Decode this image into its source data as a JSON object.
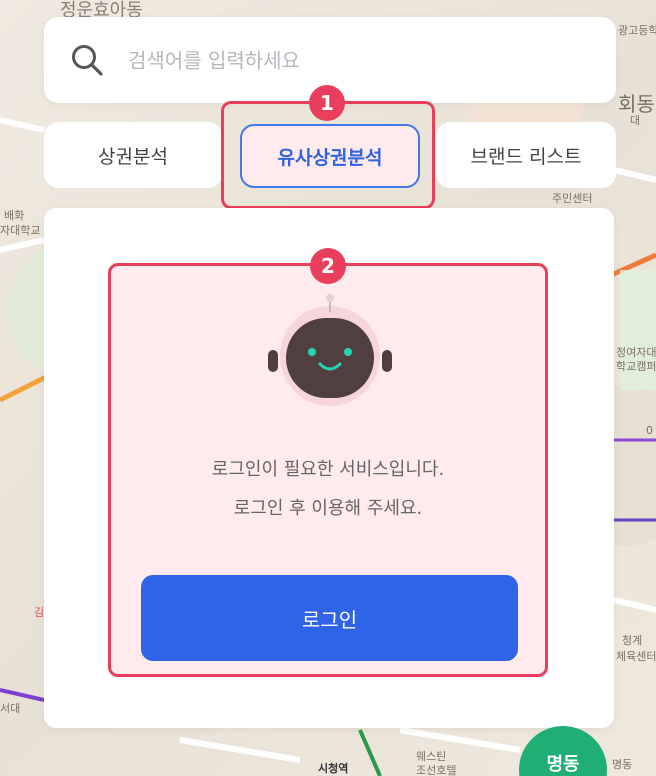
{
  "search": {
    "placeholder": "검색어를 입력하세요"
  },
  "tabs": [
    {
      "label": "상권분석"
    },
    {
      "label": "유사상권분석"
    },
    {
      "label": "브랜드 리스트"
    }
  ],
  "badges": [
    "1",
    "2"
  ],
  "panel": {
    "message_line1": "로그인이 필요한 서비스입니다.",
    "message_line2": "로그인 후 이용해 주세요.",
    "login_label": "로그인"
  },
  "map": {
    "labels": [
      "정운효아동",
      "광고등학",
      "회동",
      "대",
      "주민센터",
      "배화",
      "자대학교",
      "정여자대",
      "학교캠퍼",
      "시청역",
      "웨스틴",
      "조선호텔",
      "서대",
      "청계",
      "체육센터",
      "명동",
      "김",
      "0"
    ],
    "station_badge": "명동"
  },
  "colors": {
    "accent_blue": "#2f63e8",
    "highlight_red": "#ea3f5c",
    "highlight_fill": "#ffeaee",
    "station_green": "#1fae73"
  }
}
